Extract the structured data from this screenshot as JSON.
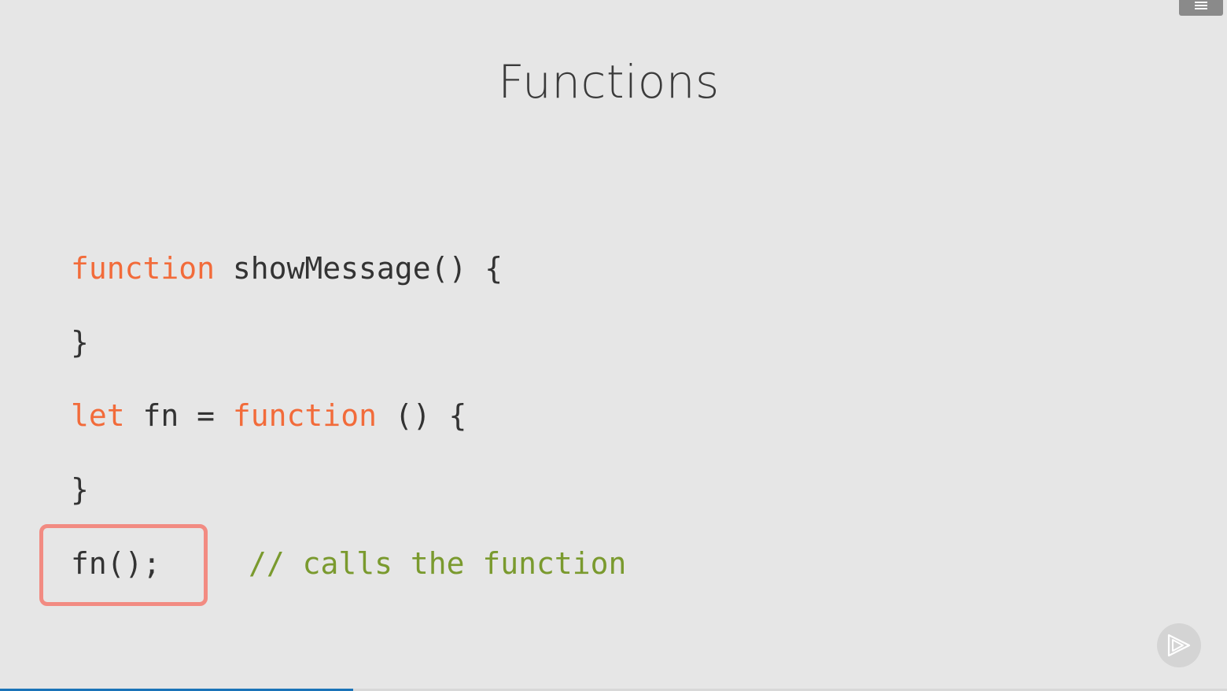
{
  "slide": {
    "title": "Functions"
  },
  "code": {
    "line1": {
      "keyword": "function",
      "rest": " showMessage() {"
    },
    "line2": {
      "text": "}"
    },
    "line3": {
      "keyword1": "let",
      "mid": " fn = ",
      "keyword2": "function",
      "rest": " () {"
    },
    "line4": {
      "text": "}"
    },
    "line5": {
      "call": "fn();",
      "comment": "// calls the function"
    }
  },
  "colors": {
    "background": "#e6e6e6",
    "keyword": "#f26b3a",
    "comment": "#7a9a2e",
    "highlight_border": "#f28b82",
    "progress": "#1a73b8"
  },
  "icons": {
    "menu": "hamburger-menu-icon",
    "player": "play-logo-icon"
  },
  "player": {
    "progress_fraction": 0.288
  }
}
